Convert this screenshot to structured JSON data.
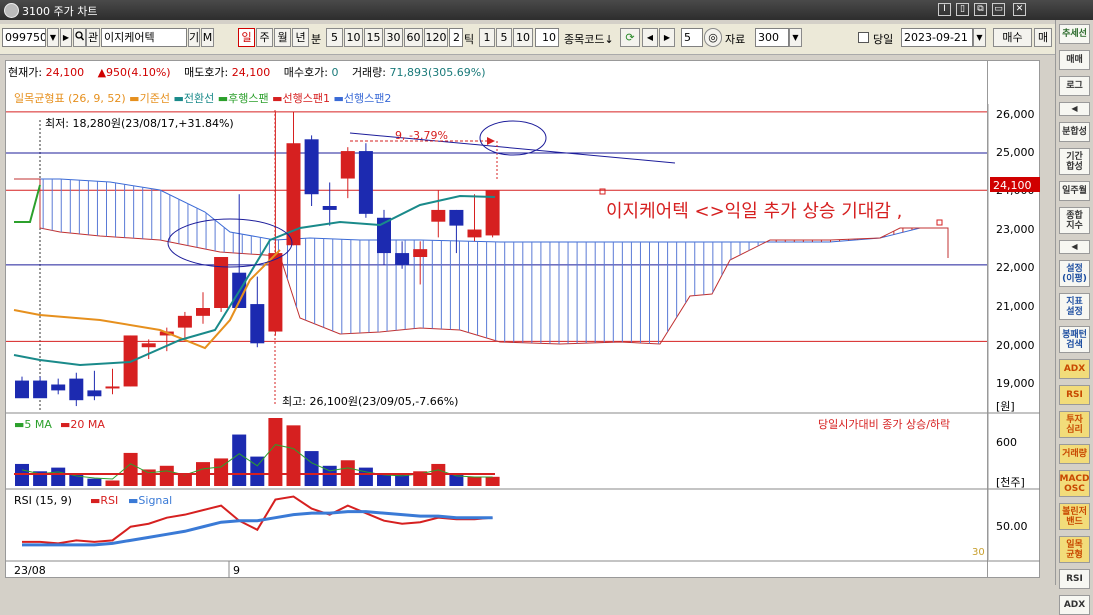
{
  "window": {
    "title": "3100 주가 차트",
    "controls": [
      "I",
      "▯",
      "⧉",
      "▭",
      "✕"
    ]
  },
  "toolbar": {
    "code": "099750",
    "search_btn": "▶",
    "search_icon": "search-icon",
    "gwan": "관",
    "stock_name": "이지케어텍",
    "gi": "기",
    "m": "M",
    "periods": [
      "일",
      "주",
      "월",
      "년"
    ],
    "selected_period": "일",
    "minute_label": "분",
    "minute_options": [
      "5",
      "10",
      "15",
      "30",
      "60",
      "120"
    ],
    "tick_input": "2",
    "tick_label": "틱",
    "tick_options": [
      "1",
      "5",
      "10"
    ],
    "extra_input": "10",
    "code_label": "종목코드↓",
    "refresh_icon": "refresh-icon",
    "prev_icon": "prev-icon",
    "next_icon": "next-icon",
    "step_value": "5",
    "data_icon": "data-icon",
    "data_label": "자료",
    "data_count": "300",
    "dangil_label": "당일",
    "date": "2023-09-21",
    "buy": "매수",
    "sell": "매"
  },
  "info": {
    "current_label": "현재가:",
    "current_value": "24,100",
    "change": "▲950(4.10%)",
    "ask_label": "매도호가:",
    "ask_value": "24,100",
    "bid_label": "매수호가:",
    "bid_value": "0",
    "volume_label": "거래량:",
    "volume_value": "71,893(305.69%)"
  },
  "legend": {
    "title": "일목균형표 (26, 9, 52)",
    "items": [
      {
        "label": "기준선",
        "color": "#e6901e"
      },
      {
        "label": "전환선",
        "color": "#1a8a8a"
      },
      {
        "label": "후행스팬",
        "color": "#2ca02c"
      },
      {
        "label": "선행스팬1",
        "color": "#d62020"
      },
      {
        "label": "선행스팬2",
        "color": "#3a6ad6"
      }
    ]
  },
  "annotations": {
    "lowest": "최저: 18,280원(23/08/17,+31.84%)",
    "highest": "최고: 26,100원(23/09/05,-7.66%)",
    "diff": "9, -3.79%",
    "headline": "이지케어텍 <>익일 추가 상승 기대감 ,",
    "price_tag": "24,100",
    "unit": "[원]"
  },
  "price_axis": {
    "ticks": [
      "26,000",
      "25,000",
      "24,000",
      "23,000",
      "22,000",
      "21,000",
      "20,000",
      "19,000"
    ]
  },
  "volume_panel": {
    "legend": [
      {
        "label": "5 MA",
        "color": "#2ca02c"
      },
      {
        "label": "20 MA",
        "color": "#d62020"
      }
    ],
    "note": "당일시가대비 종가 상승/하락",
    "tick": "600",
    "unit": "[천주]"
  },
  "rsi_panel": {
    "title": "RSI (15, 9)",
    "legend": [
      {
        "label": "RSI",
        "color": "#d62020"
      },
      {
        "label": "Signal",
        "color": "#3a7ad6"
      }
    ],
    "tick": "50.00",
    "level": "30"
  },
  "dates": {
    "first": "23/08",
    "second": "9"
  },
  "sidebar": {
    "buttons": [
      {
        "label": "추세선",
        "style": "g"
      },
      {
        "label": "매매",
        "style": ""
      },
      {
        "label": "로그",
        "style": ""
      },
      {
        "label": "◀",
        "style": "arr"
      },
      {
        "label": "분합성",
        "style": ""
      },
      {
        "label": "기간\n합성",
        "style": ""
      },
      {
        "label": "일주월",
        "style": ""
      },
      {
        "label": "종합\n지수",
        "style": ""
      },
      {
        "label": "◀",
        "style": "arr"
      },
      {
        "label": "설정\n(이평)",
        "style": "b"
      },
      {
        "label": "지표\n설정",
        "style": "b"
      },
      {
        "label": "봉패턴\n검색",
        "style": "b"
      },
      {
        "label": "ADX",
        "style": "y"
      },
      {
        "label": "RSI",
        "style": "y"
      },
      {
        "label": "투자\n심리",
        "style": "y"
      },
      {
        "label": "거래량",
        "style": "y"
      },
      {
        "label": "MACD\nOSC",
        "style": "y"
      },
      {
        "label": "볼린저\n밴드",
        "style": "y"
      },
      {
        "label": "일목\n균형",
        "style": "y"
      },
      {
        "label": "RSI",
        "style": ""
      },
      {
        "label": "ADX",
        "style": ""
      }
    ]
  },
  "chart_data": {
    "type": "candlestick",
    "ylim": [
      18500,
      26300
    ],
    "candles": [
      {
        "o": 19250,
        "h": 19350,
        "l": 18850,
        "c": 18800
      },
      {
        "o": 19250,
        "h": 19350,
        "l": 18850,
        "c": 18800
      },
      {
        "o": 19150,
        "h": 19300,
        "l": 18900,
        "c": 19000
      },
      {
        "o": 19300,
        "h": 19450,
        "l": 18600,
        "c": 18750
      },
      {
        "o": 19000,
        "h": 19500,
        "l": 18750,
        "c": 18850
      },
      {
        "o": 19050,
        "h": 19550,
        "l": 18900,
        "c": 19100
      },
      {
        "o": 19100,
        "h": 20400,
        "l": 19100,
        "c": 20400
      },
      {
        "o": 20100,
        "h": 20300,
        "l": 19800,
        "c": 20200
      },
      {
        "o": 20400,
        "h": 20600,
        "l": 20000,
        "c": 20500
      },
      {
        "o": 20600,
        "h": 21000,
        "l": 20300,
        "c": 20900
      },
      {
        "o": 20900,
        "h": 21500,
        "l": 20700,
        "c": 21100
      },
      {
        "o": 21100,
        "h": 22400,
        "l": 21000,
        "c": 22400
      },
      {
        "o": 22000,
        "h": 24000,
        "l": 21100,
        "c": 21100
      },
      {
        "o": 21200,
        "h": 21900,
        "l": 20100,
        "c": 20200
      },
      {
        "o": 20500,
        "h": 26100,
        "l": 20400,
        "c": 22500
      },
      {
        "o": 22700,
        "h": 26100,
        "l": 22700,
        "c": 25300
      },
      {
        "o": 25400,
        "h": 25500,
        "l": 23700,
        "c": 24000
      },
      {
        "o": 23700,
        "h": 24300,
        "l": 23200,
        "c": 23600
      },
      {
        "o": 24400,
        "h": 25200,
        "l": 23900,
        "c": 25100
      },
      {
        "o": 25100,
        "h": 25300,
        "l": 23400,
        "c": 23500
      },
      {
        "o": 23400,
        "h": 23600,
        "l": 22200,
        "c": 22500
      },
      {
        "o": 22500,
        "h": 22800,
        "l": 22100,
        "c": 22200
      },
      {
        "o": 22400,
        "h": 22800,
        "l": 21700,
        "c": 22600
      },
      {
        "o": 23300,
        "h": 24100,
        "l": 22900,
        "c": 23600
      },
      {
        "o": 23600,
        "h": 23600,
        "l": 22500,
        "c": 23200
      },
      {
        "o": 22900,
        "h": 24000,
        "l": 22800,
        "c": 23100
      },
      {
        "o": 22950,
        "h": 24100,
        "l": 22900,
        "c": 24100
      }
    ],
    "reference_lines": [
      26100,
      25050,
      24100,
      22200,
      20250
    ],
    "volume": [
      120,
      80,
      100,
      60,
      40,
      30,
      180,
      90,
      110,
      70,
      130,
      150,
      280,
      160,
      370,
      330,
      190,
      110,
      140,
      100,
      70,
      60,
      80,
      120,
      60,
      50,
      50
    ],
    "rsi": [
      42,
      42,
      41,
      43,
      42,
      43,
      52,
      54,
      58,
      60,
      63,
      66,
      56,
      50,
      70,
      72,
      64,
      60,
      66,
      61,
      56,
      54,
      55,
      58,
      57,
      57,
      58
    ],
    "rsi_signal": [
      40,
      40,
      40,
      40,
      40,
      41,
      43,
      45,
      47,
      49,
      52,
      55,
      56,
      56,
      58,
      60,
      61,
      61,
      62,
      62,
      61,
      60,
      59,
      59,
      58,
      58,
      58
    ]
  }
}
